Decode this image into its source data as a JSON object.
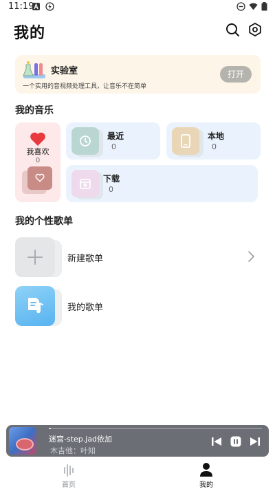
{
  "status_bar": {
    "time": "11:19",
    "icons": [
      "a-square-icon",
      "bolt-circle-icon",
      "dnd-icon",
      "wifi-icon",
      "battery-icon"
    ]
  },
  "header": {
    "title": "我的",
    "actions": [
      "search-icon",
      "settings-icon"
    ]
  },
  "lab": {
    "title": "实验室",
    "description": "一个实用的音视频处理工具，让音乐不在简单",
    "open_label": "打开"
  },
  "my_music": {
    "section_title": "我的音乐",
    "favorites": {
      "label": "我喜欢",
      "count": "0"
    },
    "tiles": [
      {
        "name": "最近",
        "count": "0",
        "icon": "clock-icon",
        "color": "#b9d6d2"
      },
      {
        "name": "本地",
        "count": "0",
        "icon": "phone-icon",
        "color": "#e8d6b6"
      },
      {
        "name": "下载",
        "count": "0",
        "icon": "download-icon",
        "color": "#efd9ec"
      }
    ]
  },
  "playlists": {
    "section_title": "我的个性歌单",
    "items": [
      {
        "name": "新建歌单",
        "icon": "plus-icon"
      },
      {
        "name": "我的歌单",
        "icon": "music-doc-icon"
      }
    ]
  },
  "player": {
    "title": "迷宫-step.jad依加",
    "artist": "木吉他：叶知",
    "progress": 0.01,
    "controls": [
      "previous-icon",
      "pause-icon",
      "next-icon"
    ]
  },
  "bottom_nav": {
    "tabs": [
      {
        "label": "首页",
        "icon": "waveform-icon",
        "active": false
      },
      {
        "label": "我的",
        "icon": "person-icon",
        "active": true
      }
    ]
  },
  "colors": {
    "accent_heart": "#e8393f",
    "lab_background": "#fdf5e8",
    "tile_background": "#eaf3fd",
    "favorites_background": "#fde9ea",
    "player_background": "#6b6f75"
  }
}
